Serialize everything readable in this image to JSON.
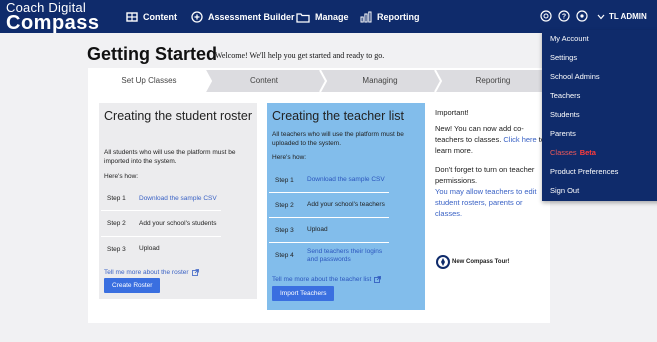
{
  "brand": {
    "line1": "Coach Digital",
    "line2": "Compass"
  },
  "nav": [
    {
      "label": "Content",
      "icon": "content-icon"
    },
    {
      "label": "Assessment Builder",
      "icon": "plus-circle-icon"
    },
    {
      "label": "Manage",
      "icon": "folder-icon"
    },
    {
      "label": "Reporting",
      "icon": "bar-chart-icon"
    }
  ],
  "user": {
    "name": "TL ADMIN",
    "icons": [
      "support-icon",
      "help-icon",
      "chevron-down-icon"
    ]
  },
  "page": {
    "title": "Getting Started",
    "subtitle": "Welcome! We'll help you get started and ready to go."
  },
  "steps": [
    "Set Up Classes",
    "Content",
    "Managing",
    "Reporting"
  ],
  "student": {
    "heading": "Creating the student roster",
    "desc": "All students who will use the platform must be imported into the system.",
    "howto": "Here's how:",
    "rows": [
      {
        "step": "Step 1",
        "text": "Download the sample CSV",
        "link": true
      },
      {
        "step": "Step 2",
        "text": "Add your school's students",
        "link": false
      },
      {
        "step": "Step 3",
        "text": "Upload",
        "link": false
      }
    ],
    "tellmore": "Tell me more about the roster",
    "button": "Create Roster"
  },
  "teacher": {
    "heading": "Creating the teacher list",
    "desc": "All teachers who will use the platform must be uploaded to the system.",
    "howto": "Here's how:",
    "rows": [
      {
        "step": "Step 1",
        "text": "Download the sample CSV",
        "link": true
      },
      {
        "step": "Step 2",
        "text": "Add your school's teachers",
        "link": false
      },
      {
        "step": "Step 3",
        "text": "Upload",
        "link": false
      },
      {
        "step": "Step 4",
        "text": "Send teachers their logins and passwords",
        "link": true
      }
    ],
    "tellmore": "Tell me more about the teacher list",
    "button": "Import Teachers"
  },
  "info": {
    "important": "Important!",
    "p1a": "New! You can now add co-teachers to classes. ",
    "p1link": "Click here",
    "p1b": " to learn more.",
    "p2": "Don't forget to turn on teacher permissions.",
    "p2link": "You may allow teachers to edit student rosters, parents or classes.",
    "tour": "New Compass Tour!"
  },
  "dropdown": {
    "items": [
      {
        "label": "My Account"
      },
      {
        "label": "Settings"
      },
      {
        "label": "School Admins"
      },
      {
        "label": "Teachers"
      },
      {
        "label": "Students"
      },
      {
        "label": "Parents"
      },
      {
        "label": "Classes",
        "badge": "Beta"
      },
      {
        "label": "Product Preferences"
      },
      {
        "label": "Sign Out"
      }
    ]
  },
  "colors": {
    "nav_bg": "#0f2b6b",
    "teacher_panel": "#82bdeb",
    "student_panel": "#ececee",
    "button": "#3a6fe0",
    "link": "#3a62c5",
    "beta": "#ff3b3b"
  }
}
